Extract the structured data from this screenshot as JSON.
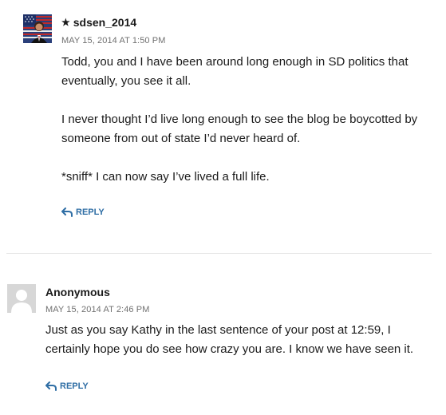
{
  "comments": [
    {
      "author": "sdsen_2014",
      "has_star": true,
      "date": "MAY 15, 2014 AT 1:50 PM",
      "paragraphs": [
        "Todd, you and I have been around long enough in SD politics that eventually, you see it all.",
        "I never thought I’d live long enough to see the blog be boycotted by someone from out of state I’d never heard of.",
        "*sniff* I can now say I’ve lived a full life."
      ],
      "reply_label": "REPLY",
      "avatar_icon": "flag-avatar-icon"
    },
    {
      "author": "Anonymous",
      "has_star": false,
      "date": "MAY 15, 2014 AT 2:46 PM",
      "paragraphs": [
        "Just as you say Kathy in the last sentence of your post at 12:59, I certainly hope you do see how crazy you are. I know we have seen it."
      ],
      "reply_label": "REPLY",
      "avatar_icon": "default-avatar-icon"
    }
  ],
  "colors": {
    "link": "#2f6ea5",
    "meta": "#707070",
    "text": "#1a1a1a",
    "divider": "#e6e6e6"
  }
}
